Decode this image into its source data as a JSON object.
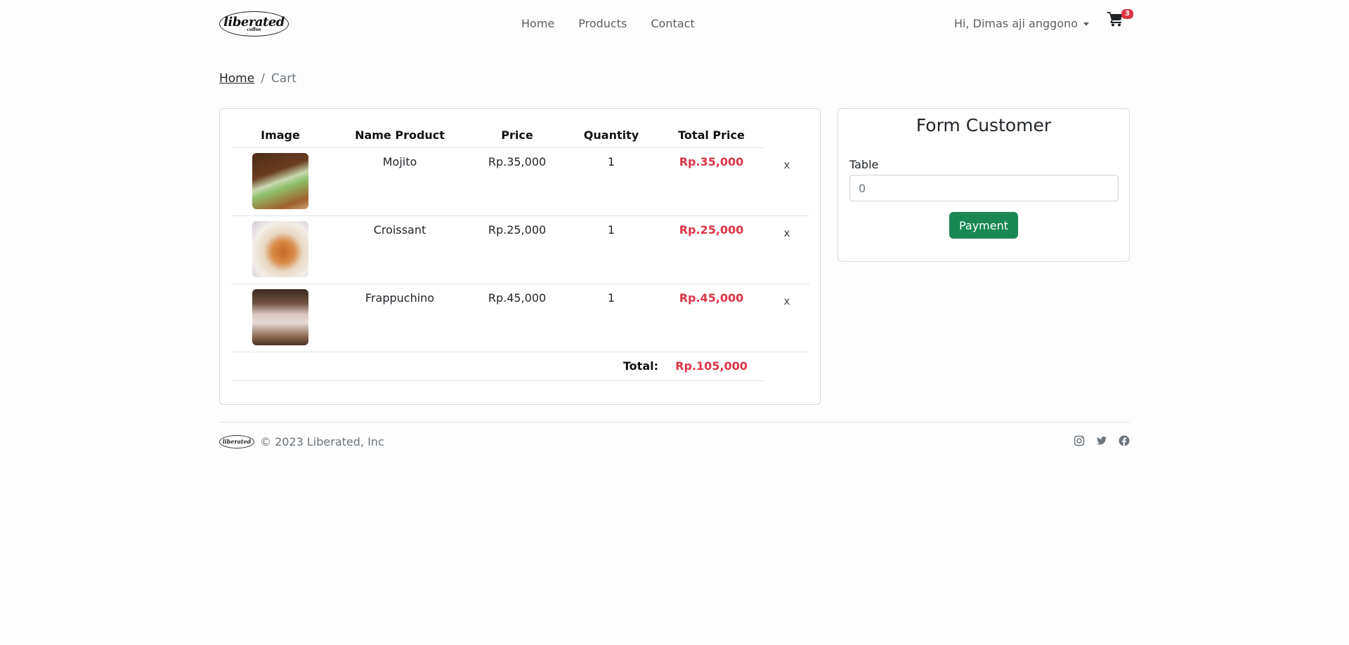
{
  "brand": {
    "logo_text": "liberated",
    "logo_subtext": "coffee"
  },
  "nav": {
    "links": [
      "Home",
      "Products",
      "Contact"
    ],
    "user_greeting": "Hi, Dimas aji anggono",
    "cart_count": "3"
  },
  "breadcrumb": {
    "home": "Home",
    "separator": "/",
    "current": "Cart"
  },
  "cart": {
    "headers": [
      "Image",
      "Name Product",
      "Price",
      "Quantity",
      "Total Price"
    ],
    "items": [
      {
        "name": "Mojito",
        "price": "Rp.35,000",
        "quantity": "1",
        "total": "Rp.35,000",
        "remove": "x",
        "image": "mojito"
      },
      {
        "name": "Croissant",
        "price": "Rp.25,000",
        "quantity": "1",
        "total": "Rp.25,000",
        "remove": "x",
        "image": "croissant"
      },
      {
        "name": "Frappuchino",
        "price": "Rp.45,000",
        "quantity": "1",
        "total": "Rp.45,000",
        "remove": "x",
        "image": "frappuccino"
      }
    ],
    "total_label": "Total:",
    "total_value": "Rp.105,000"
  },
  "form": {
    "title": "Form Customer",
    "table_label": "Table",
    "table_value": "0",
    "payment_button": "Payment"
  },
  "footer": {
    "copyright": "© 2023 Liberated, Inc",
    "socials": [
      "instagram-icon",
      "twitter-icon",
      "facebook-icon"
    ]
  },
  "colors": {
    "accent_red": "#dc3545",
    "payment_green": "#198754",
    "badge_red": "#dc3545"
  }
}
